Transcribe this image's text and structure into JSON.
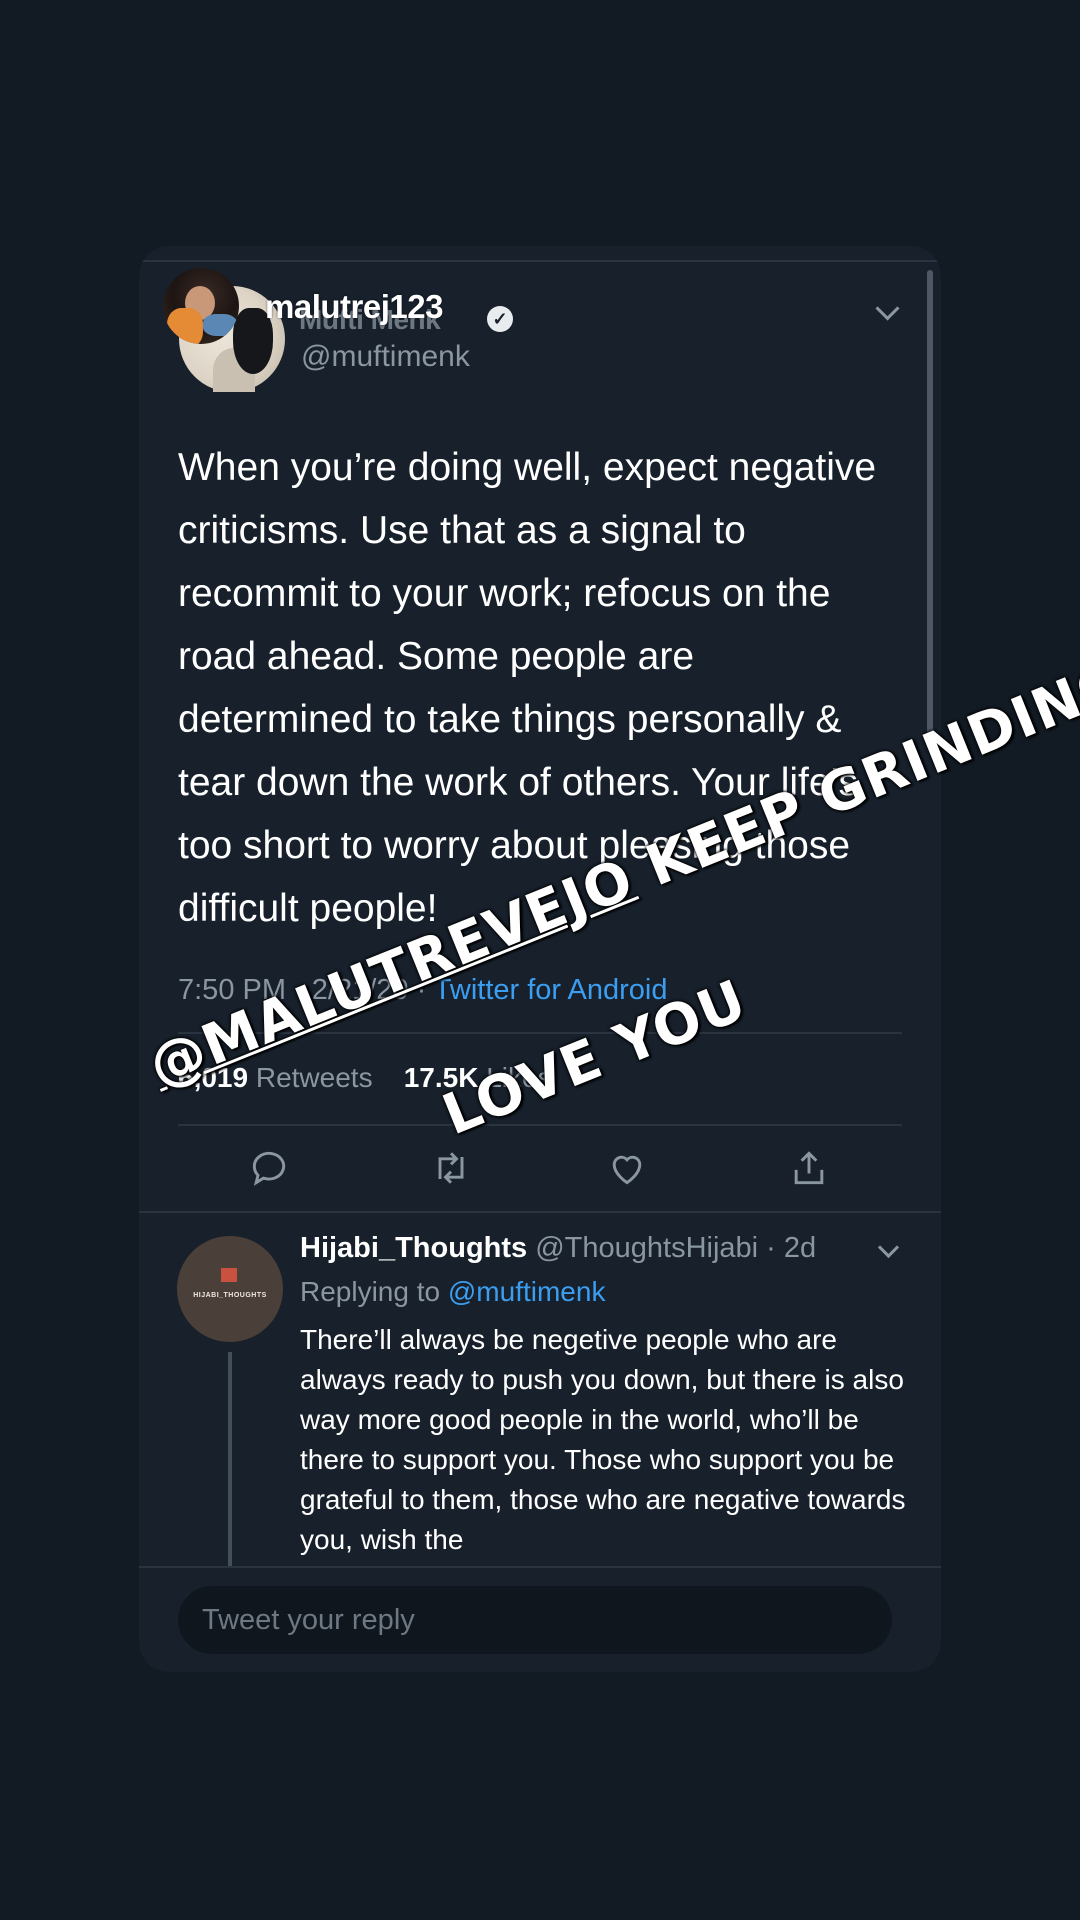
{
  "story": {
    "username": "malutrej123",
    "sticker": {
      "mention": "@MALUTREVEJO",
      "line1_rest": " KEEP GRINDING I",
      "line2": "LOVE YOU"
    }
  },
  "tweet": {
    "display_name": "Mufti Menk",
    "handle": "@muftimenk",
    "text": "When you’re doing well, expect negative criticisms. Use that as a signal to recommit to your work; refocus on the road ahead. Some people are determined to take things personally & tear down the work of others. Your life’s too short to worry about pleasing those difficult people!",
    "time": "7:50 PM · 2/21/20 · ",
    "client": "Twitter for Android",
    "retweets_count": "6,019",
    "retweets_label": "Retweets",
    "likes_count": "17.5K",
    "likes_label": "Likes"
  },
  "reply": {
    "name": "Hijabi_Thoughts",
    "handle": " @ThoughtsHijabi · 2d",
    "avatar_text": "HIJABI_THOUGHTS",
    "replying_prefix": "Replying to ",
    "replying_to": "@muftimenk",
    "text": "There’ll always be negetive people who are always ready to push you down, but there is also way more good people in the world, who’ll be there to support you. Those who support you be grateful to them, those who are negative towards you, wish the"
  },
  "composer": {
    "placeholder": "Tweet your reply"
  },
  "colors": {
    "background": "#121a23",
    "card": "#17202b",
    "accent": "#3b9ef0",
    "muted": "#8a96a1"
  }
}
